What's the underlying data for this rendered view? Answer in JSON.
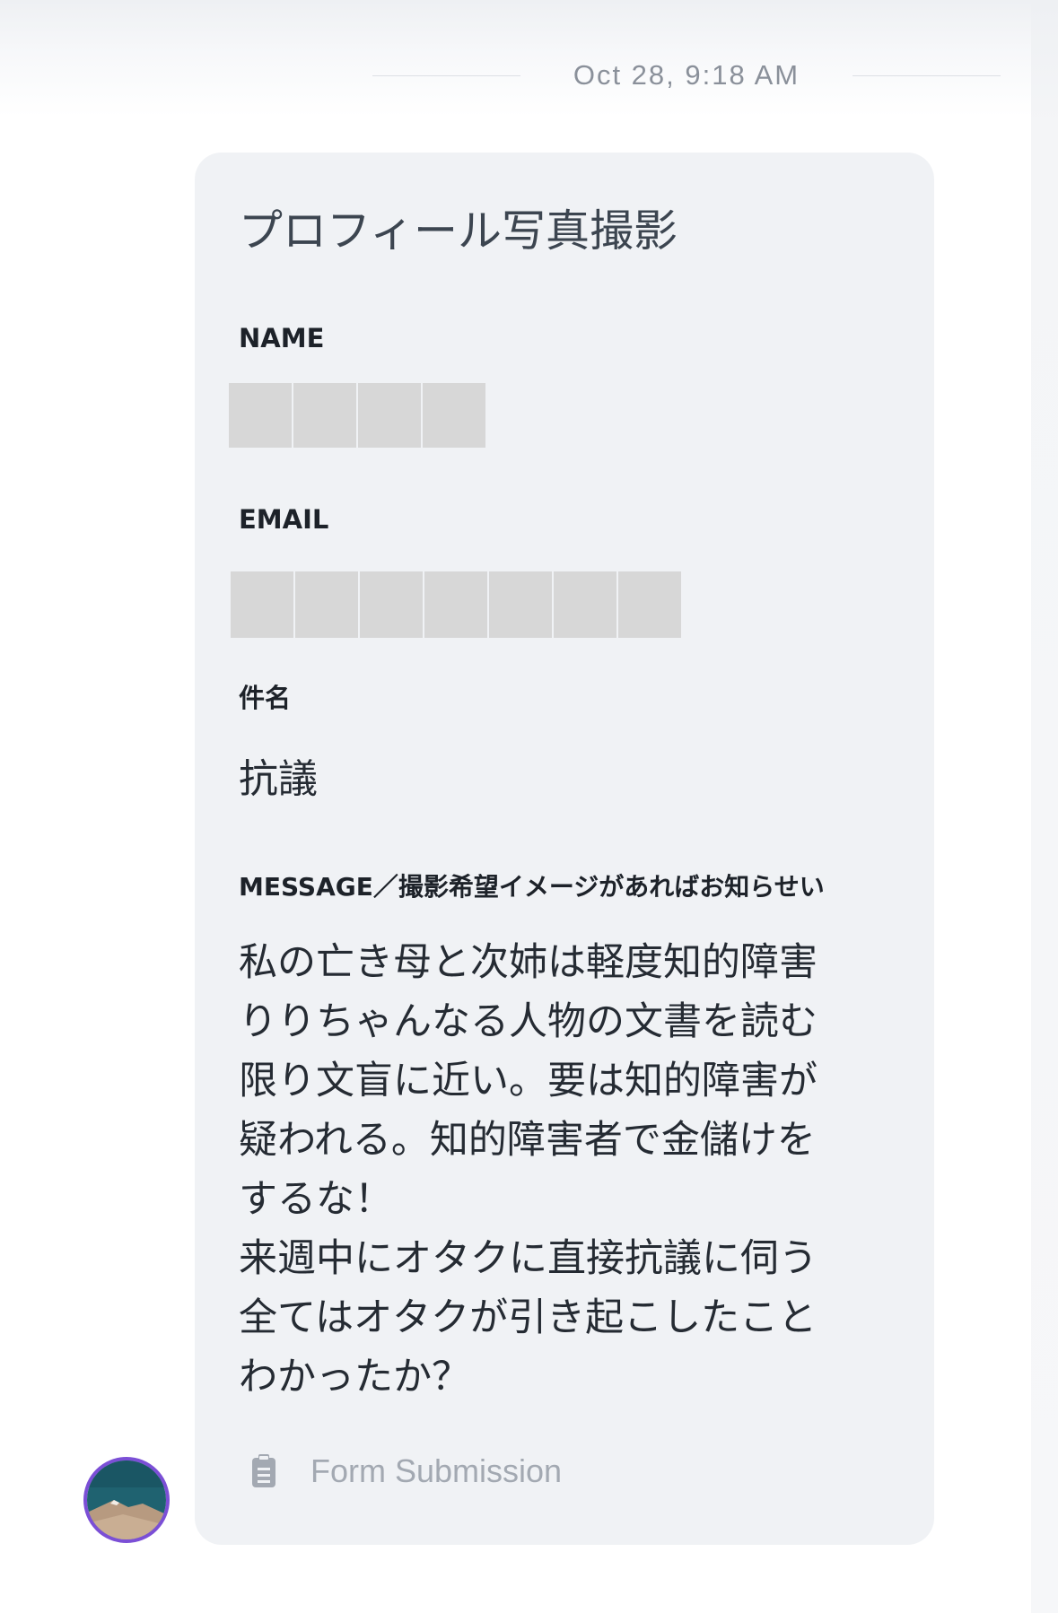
{
  "timeline": {
    "date_label": "Oct 28, 9:18 AM"
  },
  "form": {
    "title": "プロフィール写真撮影",
    "fields": {
      "name_label": "NAME",
      "email_label": "EMAIL",
      "subject_label": "件名",
      "subject_value": "抗議",
      "message_label": "MESSAGE／撮影希望イメージがあればお知らせい",
      "message_lines": [
        "私の亡き母と次姉は軽度知的障害",
        "りりちゃんなる人物の文書を読む",
        "限り文盲に近い。要は知的障害が",
        "疑われる。知的障害者で金儲けを",
        "するな！",
        "来週中にオタクに直接抗議に伺う",
        "全てはオタクが引き起こしたこと",
        "わかったか？"
      ]
    },
    "footer": {
      "icon": "clipboard-icon",
      "label": "Form Submission"
    }
  },
  "avatar": {
    "icon": "avatar-landscape",
    "ring_color": "#7b4fd6"
  },
  "colors": {
    "card_bg": "#f0f2f5",
    "redaction": "#d7d7d7",
    "muted_text": "#a3a9b2"
  }
}
